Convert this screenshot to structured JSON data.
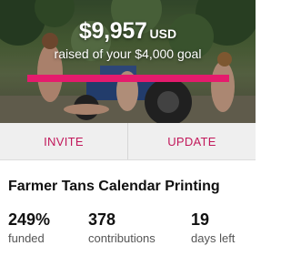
{
  "campaign": {
    "amount_raised": "$9,957",
    "currency": "USD",
    "goal_text": "raised of your $4,000 goal",
    "progress_fraction": 1.0,
    "accent_color": "#e51b6d"
  },
  "actions": {
    "invite_label": "INVITE",
    "update_label": "UPDATE"
  },
  "project": {
    "title": "Farmer Tans Calendar Printing"
  },
  "stats": [
    {
      "value": "249%",
      "label": "funded"
    },
    {
      "value": "378",
      "label": "contributions"
    },
    {
      "value": "19",
      "label": "days left"
    }
  ]
}
